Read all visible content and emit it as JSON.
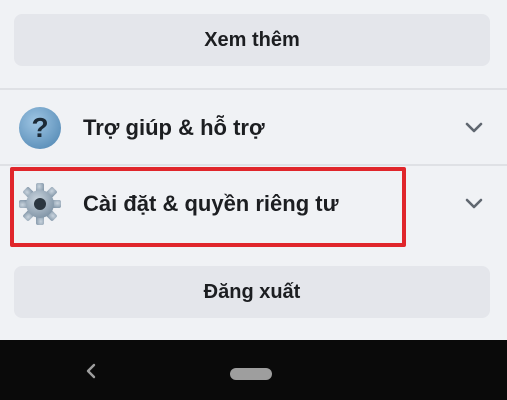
{
  "menu": {
    "see_more_label": "Xem thêm",
    "help": {
      "label": "Trợ giúp & hỗ trợ",
      "icon": "question-circle-icon"
    },
    "settings": {
      "label": "Cài đặt & quyền riêng tư",
      "icon": "gear-icon",
      "highlighted": true
    },
    "logout_label": "Đăng xuất"
  },
  "colors": {
    "background": "#f0f2f5",
    "button": "#e4e6eb",
    "highlight": "#e0262b",
    "navbar": "#0a0a0a"
  }
}
